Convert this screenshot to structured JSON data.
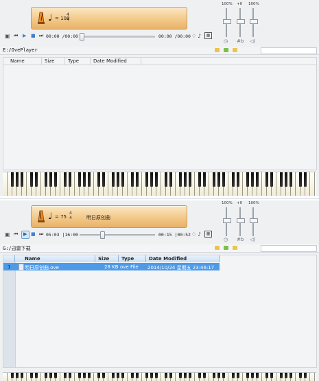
{
  "top": {
    "display": {
      "tempo": "= 100",
      "ts_num": "4",
      "ts_den": "4"
    },
    "transport": {
      "time_left": "00:00 /00:00",
      "time_right": "00:00 /00:00",
      "progress": 0.0
    },
    "faders": [
      {
        "label": "100%",
        "level": 1.0,
        "icon": "metronome-icon"
      },
      {
        "label": "+0",
        "level": 0.5,
        "icon": "pitch-icon"
      },
      {
        "label": "100%",
        "level": 1.0,
        "icon": "volume-icon"
      }
    ],
    "path": "E:/OvePlayer",
    "columns": [
      "Name",
      "Size",
      "Type",
      "Date Modified"
    ]
  },
  "bottom": {
    "display": {
      "tempo": "= 75",
      "ts_num": "4",
      "ts_den": "4",
      "song": "明日原创曲"
    },
    "transport": {
      "time_left": "05:03 |16:00",
      "time_right": "00:15 |00:52",
      "progress": 0.29
    },
    "faders": [
      {
        "label": "100%",
        "level": 1.0,
        "icon": "metronome-icon"
      },
      {
        "label": "+0",
        "level": 0.5,
        "icon": "pitch-icon"
      },
      {
        "label": "100%",
        "level": 1.0,
        "icon": "volume-icon"
      }
    ],
    "path": "G:/迅雷下载",
    "columns": [
      "Name",
      "Size",
      "Type",
      "Date Modified"
    ],
    "rows": [
      {
        "index": "1",
        "name": "明日原创曲.ove",
        "size": "28 KB",
        "type": "ove File",
        "modified": "2014/10/24 星期五 23:46:17"
      }
    ]
  },
  "colors": {
    "accent": "#4d9ae8",
    "display": "#f3c98a"
  }
}
